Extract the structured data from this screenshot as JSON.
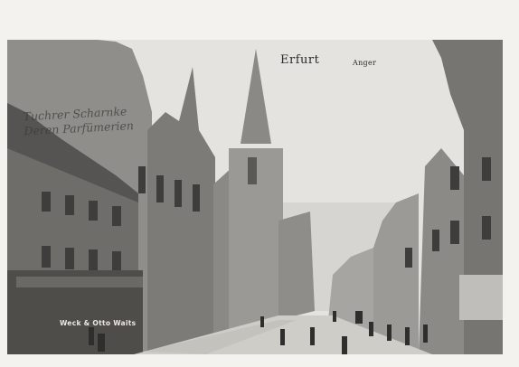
{
  "postcard": {
    "city": "Erfurt",
    "street": "Anger"
  },
  "signs": {
    "wall_ad_line1": "Tuchrer Scharnke",
    "wall_ad_line2": "Deren Parfümerien",
    "shop_sign": "Weck & Otto Waits"
  },
  "colors": {
    "sky": "#e3e2de",
    "street": "#cfcdc8",
    "buildings_dark": "#5e5d5a",
    "buildings_mid": "#8d8c88",
    "border": "#0e0e0e"
  }
}
